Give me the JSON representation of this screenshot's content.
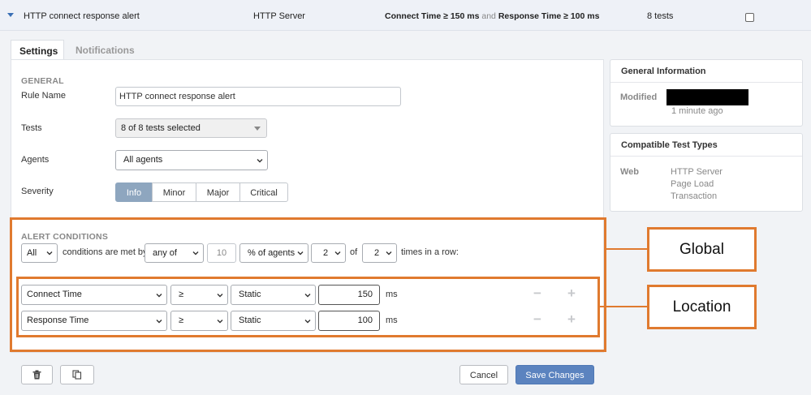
{
  "rule_row": {
    "name": "HTTP connect response alert",
    "test_type": "HTTP Server",
    "cond_metric1": "Connect Time ≥ 150 ms",
    "cond_and": "and",
    "cond_metric2": "Response Time ≥ 100 ms",
    "test_count": "8 tests"
  },
  "tabs": [
    "Settings",
    "Notifications"
  ],
  "general": {
    "section_title": "GENERAL",
    "rule_name_label": "Rule Name",
    "rule_name_value": "HTTP connect response alert",
    "tests_label": "Tests",
    "tests_value": "8 of 8 tests selected",
    "agents_label": "Agents",
    "agents_value": "All agents",
    "severity_label": "Severity",
    "severity_options": [
      "Info",
      "Minor",
      "Major",
      "Critical"
    ],
    "severity_selected": "Info"
  },
  "alert": {
    "section_title": "ALERT CONDITIONS",
    "match_mode": "All",
    "met_by_text": "conditions are met by",
    "scope_mode": "any of",
    "scope_value": "10",
    "scope_unit": "% of agents",
    "n_value": "2",
    "of_text": "of",
    "m_value": "2",
    "times_text": "times in a row:",
    "conditions": [
      {
        "metric": "Connect Time",
        "operator": "≥",
        "type": "Static",
        "value": "150",
        "unit": "ms"
      },
      {
        "metric": "Response Time",
        "operator": "≥",
        "type": "Static",
        "value": "100",
        "unit": "ms"
      }
    ]
  },
  "general_info": {
    "title": "General Information",
    "modified_label": "Modified",
    "modified_ago": "1 minute ago"
  },
  "compatible": {
    "title": "Compatible Test Types",
    "category": "Web",
    "types": [
      "HTTP Server",
      "Page Load",
      "Transaction"
    ]
  },
  "actions": {
    "delete_icon": "trash-icon",
    "copy_icon": "copy-icon",
    "cancel": "Cancel",
    "save": "Save Changes"
  },
  "annotations": {
    "global": "Global",
    "location": "Location",
    "color": "#e07a2f"
  }
}
